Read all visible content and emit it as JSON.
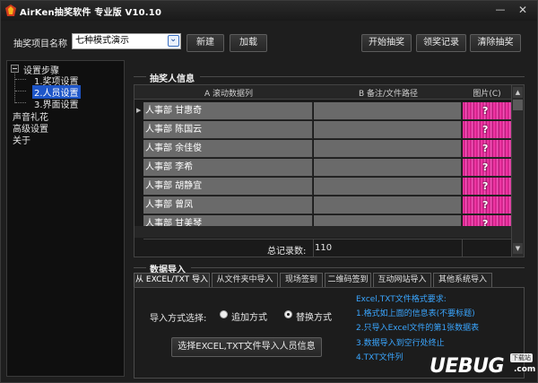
{
  "window": {
    "title": "AirKen抽奖软件 专业版 V10.10",
    "minimize": "—",
    "close": "✕"
  },
  "toolbar": {
    "project_label": "抽奖项目名称",
    "project_value": "七种模式演示",
    "new_label": "新建",
    "load_label": "加载",
    "start_label": "开始抽奖",
    "record_label": "领奖记录",
    "clear_label": "清除抽奖"
  },
  "tree": {
    "root": "设置步骤",
    "children": [
      "1.奖项设置",
      "2.人员设置",
      "3.界面设置"
    ],
    "selected_index": 1,
    "items": [
      "声音礼花",
      "高级设置",
      "关于"
    ]
  },
  "winners": {
    "group_title": "抽奖人信息",
    "columns": [
      "A 滚动数据列",
      "B 备注/文件路径",
      "图片(C)"
    ],
    "rows": [
      {
        "a": "人事部 甘惠奇",
        "b": "",
        "c": "?"
      },
      {
        "a": "人事部 陈国云",
        "b": "",
        "c": "?"
      },
      {
        "a": "人事部 余佳俊",
        "b": "",
        "c": "?"
      },
      {
        "a": "人事部 李希",
        "b": "",
        "c": "?"
      },
      {
        "a": "人事部 胡静宜",
        "b": "",
        "c": "?"
      },
      {
        "a": "人事部 曾凤",
        "b": "",
        "c": "?"
      },
      {
        "a": "人事部 甘美琴",
        "b": "",
        "c": "?"
      }
    ],
    "total_label": "总记录数:",
    "total_value": "110",
    "current_row_marker": "▶"
  },
  "import": {
    "group_title": "数据导入",
    "tabs": [
      "从 EXCEL/TXT 导入",
      "从文件夹中导入",
      "现场签到",
      "二维码签到",
      "互动网站导入",
      "其他系统导入"
    ],
    "active_tab": 0,
    "mode_label": "导入方式选择:",
    "mode_options": [
      "追加方式",
      "替换方式"
    ],
    "mode_selected": 1,
    "import_button": "选择EXCEL,TXT文件导入人员信息",
    "help_lines": [
      "Excel,TXT文件格式要求:",
      "1.格式如上面的信息表(不要标题)",
      "2.只导入Excel文件的第1张数据表",
      "3.数据导入到空行处终止",
      "4.TXT文件列"
    ]
  },
  "watermark": {
    "text": "UEBUG",
    "badge": "下载站",
    "suffix": ".com"
  },
  "colors": {
    "accent_blue": "#1e56c8",
    "help_text": "#3aa6ff",
    "picture_pink": "#ff3fb0"
  }
}
